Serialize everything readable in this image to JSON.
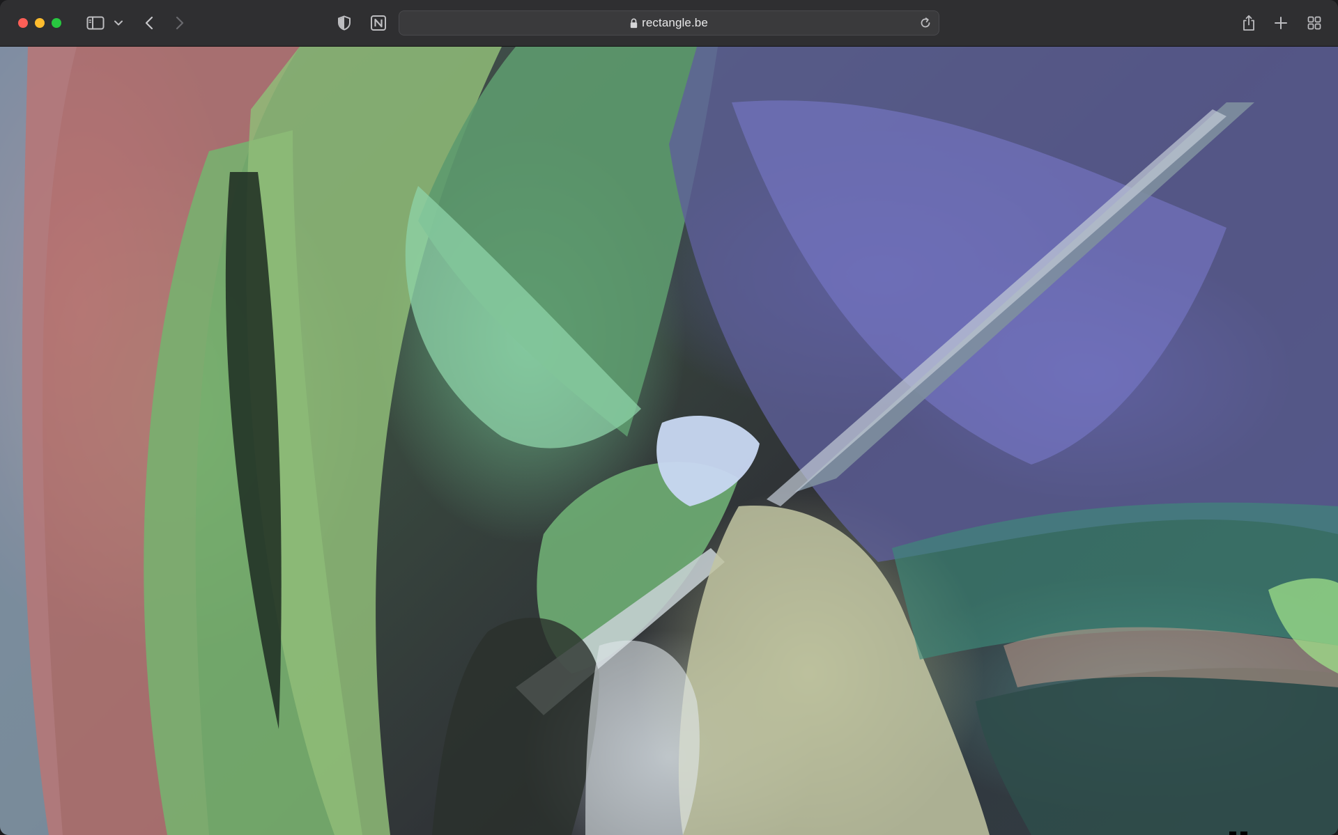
{
  "browser": {
    "url": "rectangle.be",
    "icons": {
      "sidebar": "sidebar-icon",
      "chevron": "chevron-down-icon",
      "back": "back-icon",
      "forward": "forward-icon",
      "privacy": "shield-icon",
      "extension": "notion-icon",
      "lock": "lock-icon",
      "reload": "reload-icon",
      "share": "share-icon",
      "new_tab": "plus-icon",
      "tabs": "tab-overview-icon"
    }
  },
  "media_controls": {
    "pause_icon": "pause-icon",
    "volume_icon": "volume-icon"
  }
}
